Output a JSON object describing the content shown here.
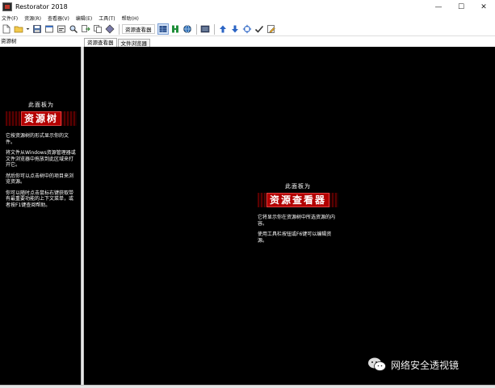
{
  "window": {
    "title": "Restorator 2018",
    "minimize_glyph": "—",
    "maximize_glyph": "☐",
    "close_glyph": "✕"
  },
  "menu": [
    {
      "label": "文件(F)"
    },
    {
      "label": "资源(R)"
    },
    {
      "label": "查看器(V)"
    },
    {
      "label": "编辑(E)"
    },
    {
      "label": "工具(T)"
    },
    {
      "label": "帮助(H)"
    }
  ],
  "toolbar": {
    "resource_viewer_label": "资源查看器",
    "icons": [
      "new-file-icon",
      "open-folder-icon",
      "dropdown-arrow-icon",
      "save-icon",
      "window-icon",
      "dialog-icon",
      "search-icon",
      "extract-icon",
      "copy-icon",
      "diamond-icon",
      "grid-view-icon",
      "green-bar-icon",
      "globe-icon",
      "hex-view-icon",
      "arrow-up-icon",
      "arrow-down-icon",
      "crosshair-icon",
      "check-icon",
      "edit-page-icon"
    ]
  },
  "left_panel": {
    "header": "资源树",
    "caption": "此面板为",
    "banner": "资源树",
    "paragraphs": [
      "它按资源树的形式显示你的文件。",
      "将文件从Windows资源管理器或文件浏览器中拖放到此区域来打开它。",
      "然后你可以点击树中的项目来浏览资源。",
      "你可以随时点击鼠标右键获取带有最重要功能的上下文菜单，或者按F1键查阅帮助。"
    ]
  },
  "tabs": [
    {
      "label": "资源查看器",
      "active": true
    },
    {
      "label": "文件浏览器",
      "active": false
    }
  ],
  "right_panel": {
    "caption": "此面板为",
    "banner": "资源查看器",
    "paragraphs": [
      "它将显示你在资源树中所选资源的内容。",
      "使用工具栏按钮或F6键可以编辑资源。"
    ]
  },
  "watermark": {
    "text": "网络安全透视镜"
  },
  "colors": {
    "pane_background": "#000000",
    "banner_red": "#b30000",
    "chrome": "#ffffff"
  }
}
